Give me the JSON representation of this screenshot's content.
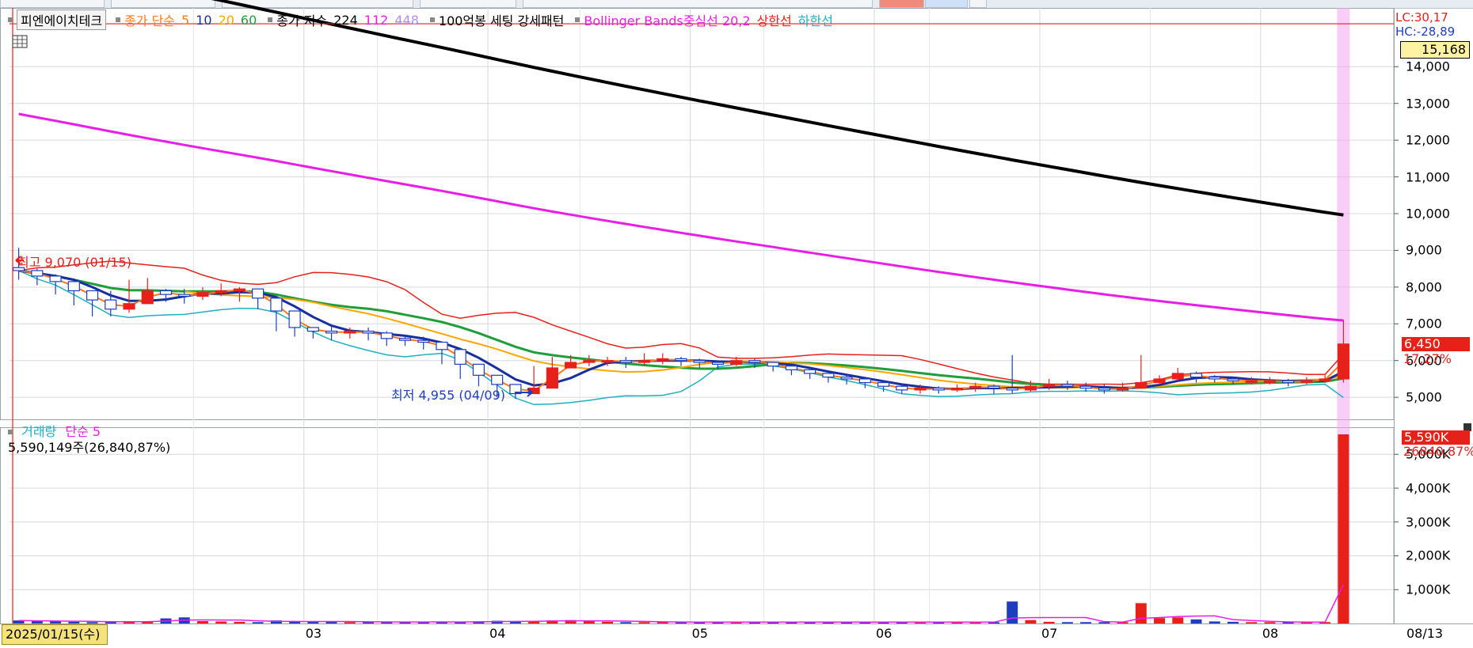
{
  "colors": {
    "up": "#e8201a",
    "down": "#1d3fbf",
    "ma5": "#ff7a1a",
    "ma10": "#1a2f9e",
    "ma20": "#ffa500",
    "ma60": "#1f9e3a",
    "ma224": "#000000",
    "ma112": "#e81ee8",
    "ma448": "#b48cf0",
    "bb_mid": "#e8201a",
    "bb_low": "#1fb0c0",
    "volume_ma": "#e81ee8"
  },
  "legend": {
    "title": "피엔에이치테크",
    "close_simple": "종가 단순",
    "ma5": "5",
    "ma10": "10",
    "ma20": "20",
    "ma60": "60",
    "close_index": "종가 지수",
    "ma224": "224",
    "ma112": "112",
    "ma448": "448",
    "pattern": "100억봉 세팅 강세패턴",
    "bollinger": "Bollinger Bands중심선 20,2",
    "upper_line": "상한선",
    "lower_line": "하한선"
  },
  "volume_legend": {
    "label": "거래량",
    "ma_label": "단순 5",
    "value": "5,590,149주(26,840,87%)"
  },
  "right_panel": {
    "lc": "LC:30,17",
    "hc": "HC:-28,89",
    "current_box": "15,168",
    "price_tag": "6,450",
    "price_pct": "17,27%",
    "volume_tag": "5,590K",
    "volume_pct": "26840,87%"
  },
  "annotations": {
    "high": "최고 9,070 (01/15)",
    "low": "최저 4,955 (04/09)"
  },
  "x_axis": {
    "start_date": "2025/01/15(수)",
    "months": [
      "03",
      "04",
      "05",
      "06",
      "07",
      "08"
    ],
    "end_label": "08/13"
  },
  "chart_data": [
    {
      "type": "candlestick",
      "title": "피엔에이치테크",
      "y_ticks": [
        "5,000",
        "6,000",
        "7,000",
        "8,000",
        "9,000",
        "10,000",
        "11,000",
        "12,000",
        "13,000",
        "14,000"
      ],
      "ylim": [
        4400,
        15600
      ],
      "x": [
        "01/15",
        "01/17",
        "01/21",
        "01/23",
        "01/27",
        "01/31",
        "02/04",
        "02/06",
        "02/10",
        "02/12",
        "02/14",
        "02/18",
        "02/20",
        "02/24",
        "02/26",
        "02/28",
        "03/05",
        "03/07",
        "03/11",
        "03/13",
        "03/17",
        "03/19",
        "03/21",
        "03/25",
        "03/27",
        "03/31",
        "04/02",
        "04/04",
        "04/08",
        "04/10",
        "04/14",
        "04/16",
        "04/18",
        "04/22",
        "04/24",
        "04/28",
        "04/30",
        "05/06",
        "05/08",
        "05/12",
        "05/14",
        "05/16",
        "05/20",
        "05/22",
        "05/26",
        "05/28",
        "05/30",
        "06/04",
        "06/09",
        "06/11",
        "06/13",
        "06/17",
        "06/19",
        "06/23",
        "06/25",
        "06/27",
        "07/01",
        "07/03",
        "07/07",
        "07/09",
        "07/11",
        "07/15",
        "07/17",
        "07/21",
        "07/23",
        "07/25",
        "07/29",
        "07/31",
        "08/04",
        "08/06",
        "08/08",
        "08/11",
        "08/13"
      ],
      "close": [
        8450,
        8300,
        8150,
        7900,
        7650,
        7400,
        7550,
        7900,
        7800,
        7750,
        7850,
        7900,
        7950,
        7700,
        7350,
        6900,
        6800,
        6750,
        6800,
        6750,
        6600,
        6550,
        6500,
        6300,
        5900,
        5600,
        5350,
        5100,
        5250,
        5800,
        5950,
        6000,
        6000,
        5950,
        6000,
        6050,
        6000,
        5950,
        5900,
        6000,
        5950,
        5850,
        5750,
        5650,
        5550,
        5500,
        5400,
        5300,
        5200,
        5250,
        5200,
        5250,
        5300,
        5250,
        5200,
        5300,
        5350,
        5300,
        5250,
        5200,
        5250,
        5400,
        5500,
        5650,
        5550,
        5500,
        5450,
        5450,
        5450,
        5400,
        5450,
        5500,
        6450
      ],
      "high": [
        9070,
        8500,
        8350,
        8100,
        7850,
        7900,
        8200,
        8250,
        7950,
        7950,
        8000,
        8100,
        8000,
        7850,
        7500,
        7100,
        6900,
        6950,
        6900,
        6900,
        6800,
        6700,
        6650,
        6500,
        6100,
        5800,
        5500,
        5350,
        5850,
        6100,
        6150,
        6150,
        6100,
        6100,
        6200,
        6200,
        6100,
        6050,
        6000,
        6100,
        6050,
        5950,
        5850,
        5750,
        5650,
        5600,
        5550,
        5450,
        5350,
        5350,
        5300,
        5350,
        5400,
        5350,
        6150,
        5450,
        5500,
        5450,
        5400,
        5350,
        5400,
        6150,
        5600,
        5800,
        5700,
        5600,
        5550,
        5550,
        5550,
        5500,
        5550,
        5600,
        7100
      ],
      "low": [
        8200,
        8050,
        7800,
        7500,
        7200,
        7200,
        7300,
        7600,
        7600,
        7550,
        7650,
        7750,
        7600,
        7400,
        6800,
        6650,
        6600,
        6550,
        6600,
        6550,
        6400,
        6400,
        6300,
        5900,
        5500,
        5300,
        5000,
        4955,
        5100,
        5500,
        5800,
        5850,
        5850,
        5800,
        5850,
        5900,
        5850,
        5800,
        5750,
        5850,
        5800,
        5700,
        5600,
        5500,
        5400,
        5350,
        5250,
        5150,
        5100,
        5100,
        5100,
        5150,
        5150,
        5100,
        5100,
        5150,
        5200,
        5200,
        5150,
        5100,
        5150,
        5250,
        5350,
        5450,
        5400,
        5400,
        5350,
        5350,
        5350,
        5300,
        5350,
        5400,
        5400
      ]
    },
    {
      "type": "bar",
      "title": "거래량",
      "y_ticks": [
        "1,000K",
        "2,000K",
        "3,000K",
        "4,000K",
        "5,000K"
      ],
      "ylim": [
        0,
        5800
      ],
      "unit": "K",
      "values": [
        90,
        70,
        60,
        50,
        40,
        40,
        70,
        60,
        150,
        180,
        70,
        60,
        50,
        40,
        90,
        60,
        50,
        50,
        40,
        50,
        40,
        40,
        50,
        50,
        40,
        60,
        80,
        70,
        60,
        90,
        100,
        70,
        50,
        40,
        40,
        50,
        40,
        40,
        40,
        40,
        40,
        40,
        50,
        40,
        40,
        40,
        40,
        40,
        40,
        40,
        40,
        40,
        40,
        40,
        650,
        100,
        50,
        40,
        40,
        40,
        40,
        600,
        160,
        180,
        120,
        60,
        50,
        40,
        40,
        40,
        40,
        40,
        5590
      ]
    }
  ]
}
